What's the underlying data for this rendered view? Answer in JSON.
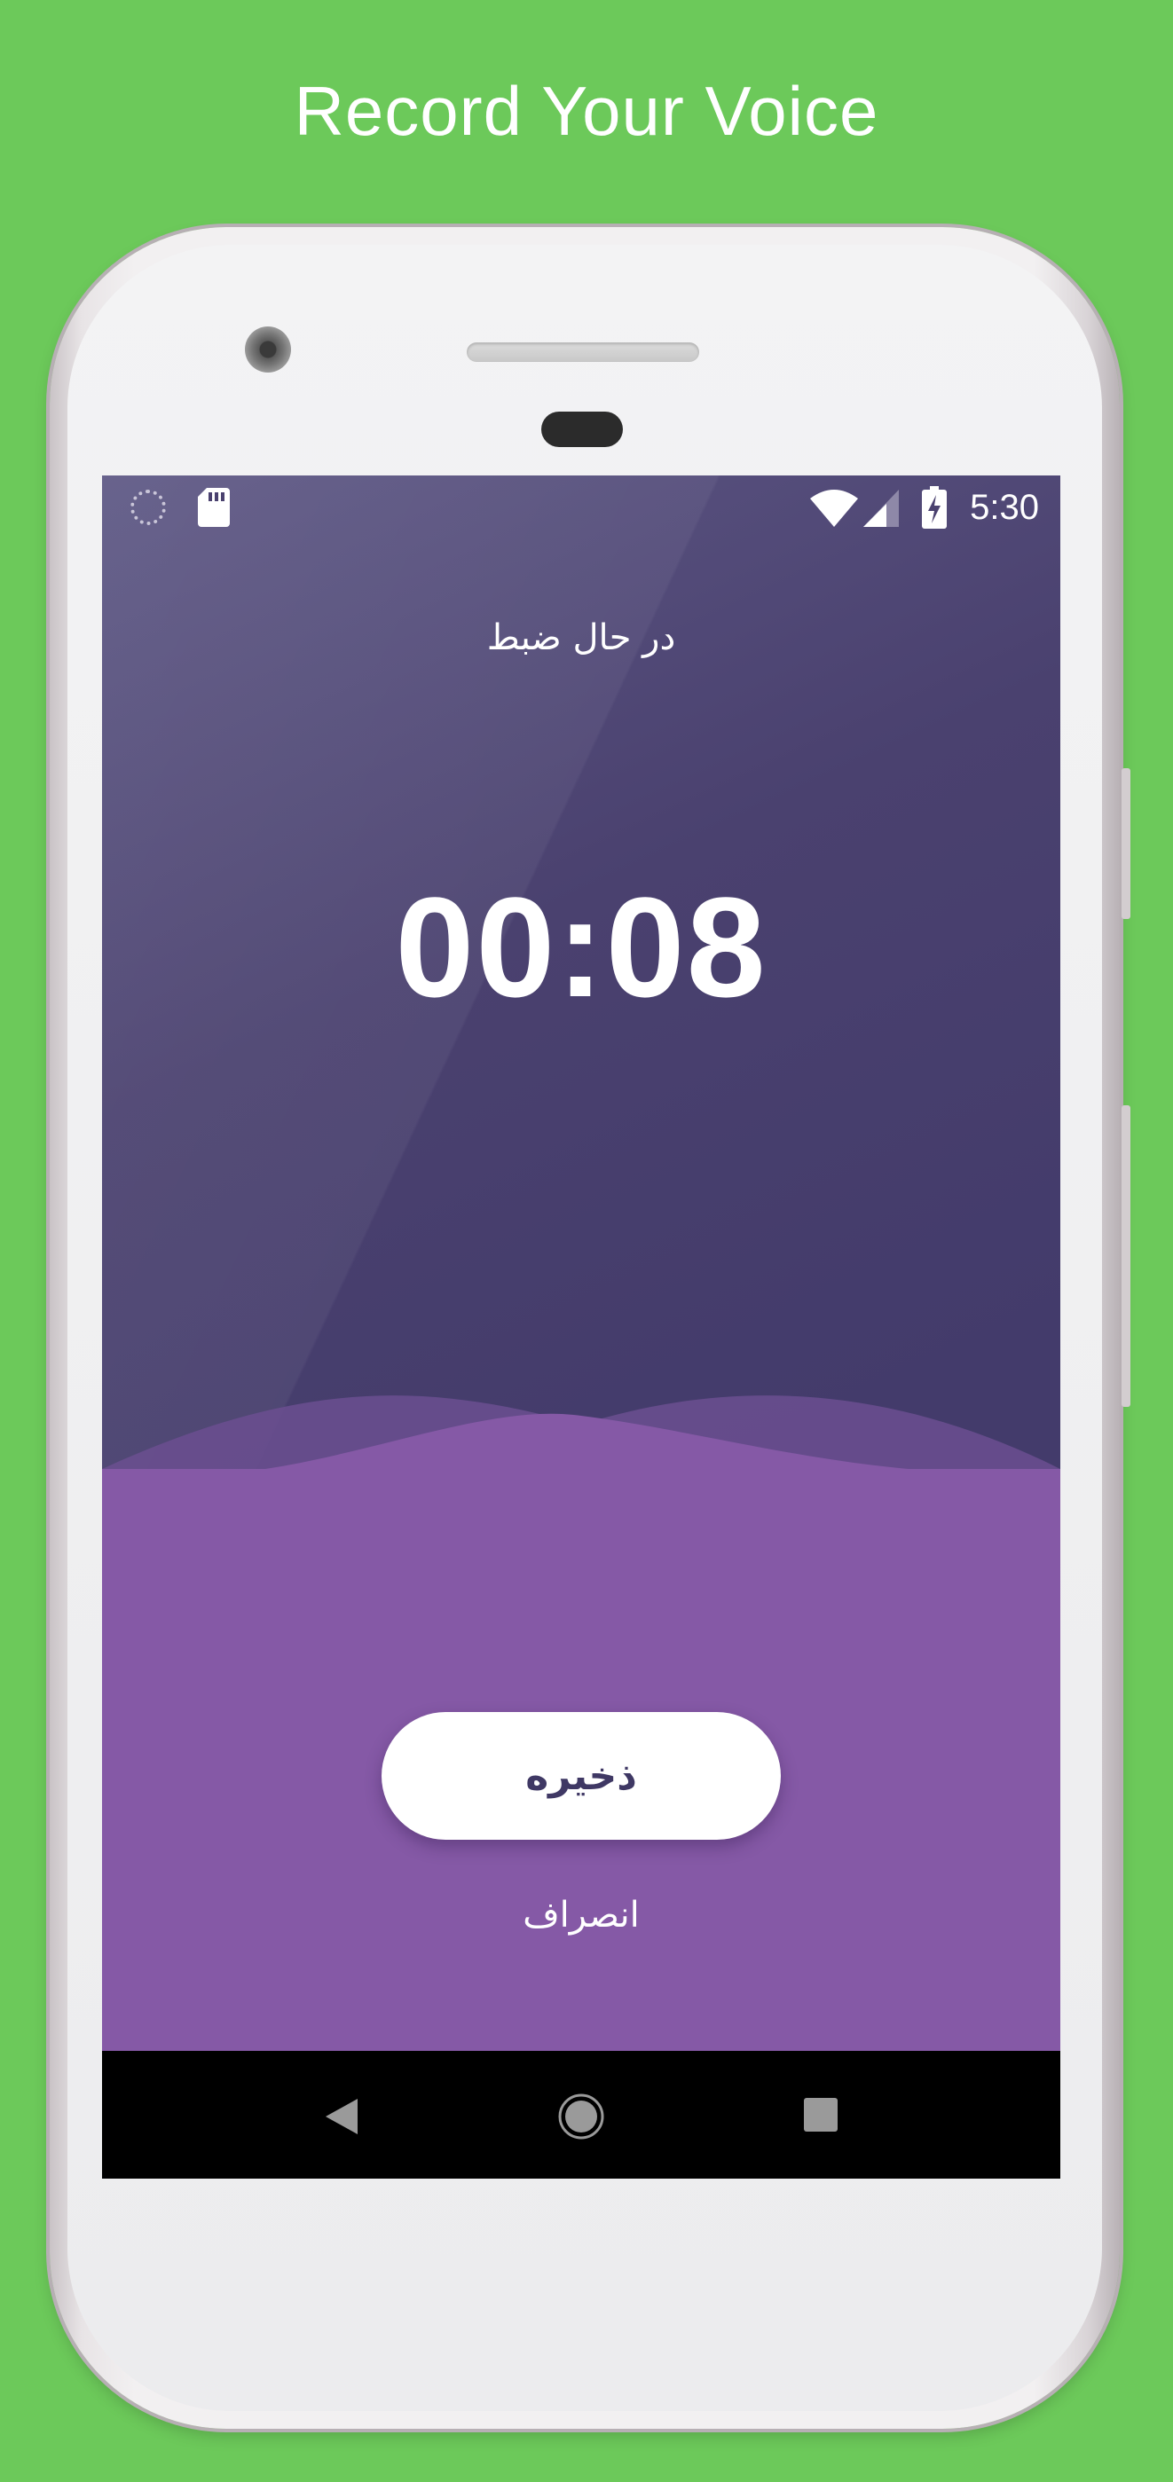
{
  "promo": {
    "title": "Record Your Voice"
  },
  "status_bar": {
    "time": "5:30",
    "icons": [
      "loading-spinner-icon",
      "sd-card-icon",
      "wifi-icon",
      "signal-icon",
      "battery-charging-icon"
    ]
  },
  "recorder": {
    "status_label": "در حال ضبط",
    "elapsed": "00:08",
    "save_label": "ذخیره",
    "cancel_label": "انصراف"
  },
  "nav_bar": {
    "icons": [
      "back-icon",
      "home-icon",
      "recents-icon"
    ]
  },
  "colors": {
    "promo_background": "#6cc95a",
    "screen_top": "#433b6b",
    "screen_bottom": "#8559a6",
    "wave_overlay": "#6b4f91",
    "button_text": "#3f3864"
  }
}
